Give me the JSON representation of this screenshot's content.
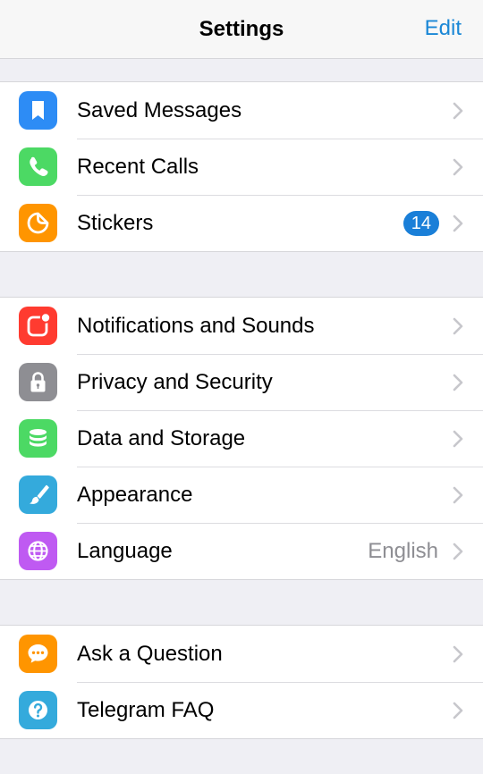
{
  "header": {
    "title": "Settings",
    "edit_label": "Edit"
  },
  "sections": [
    {
      "items": [
        {
          "label": "Saved Messages",
          "icon": "bookmark-icon",
          "color": "#2d8cf5"
        },
        {
          "label": "Recent Calls",
          "icon": "phone-icon",
          "color": "#4cd964"
        },
        {
          "label": "Stickers",
          "icon": "sticker-icon",
          "color": "#ff9500",
          "badge": "14"
        }
      ]
    },
    {
      "items": [
        {
          "label": "Notifications and Sounds",
          "icon": "notification-icon",
          "color": "#ff3b30"
        },
        {
          "label": "Privacy and Security",
          "icon": "lock-icon",
          "color": "#8e8e93"
        },
        {
          "label": "Data and Storage",
          "icon": "database-icon",
          "color": "#4cd964"
        },
        {
          "label": "Appearance",
          "icon": "brush-icon",
          "color": "#34aadc"
        },
        {
          "label": "Language",
          "icon": "globe-icon",
          "color": "#bf5af2",
          "value": "English"
        }
      ]
    },
    {
      "items": [
        {
          "label": "Ask a Question",
          "icon": "chat-bubble-icon",
          "color": "#ff9500"
        },
        {
          "label": "Telegram FAQ",
          "icon": "question-icon",
          "color": "#34aadc"
        }
      ]
    }
  ],
  "colors": {
    "accent": "#1a87d6",
    "badge": "#1a7fd8",
    "background": "#efeff4"
  }
}
